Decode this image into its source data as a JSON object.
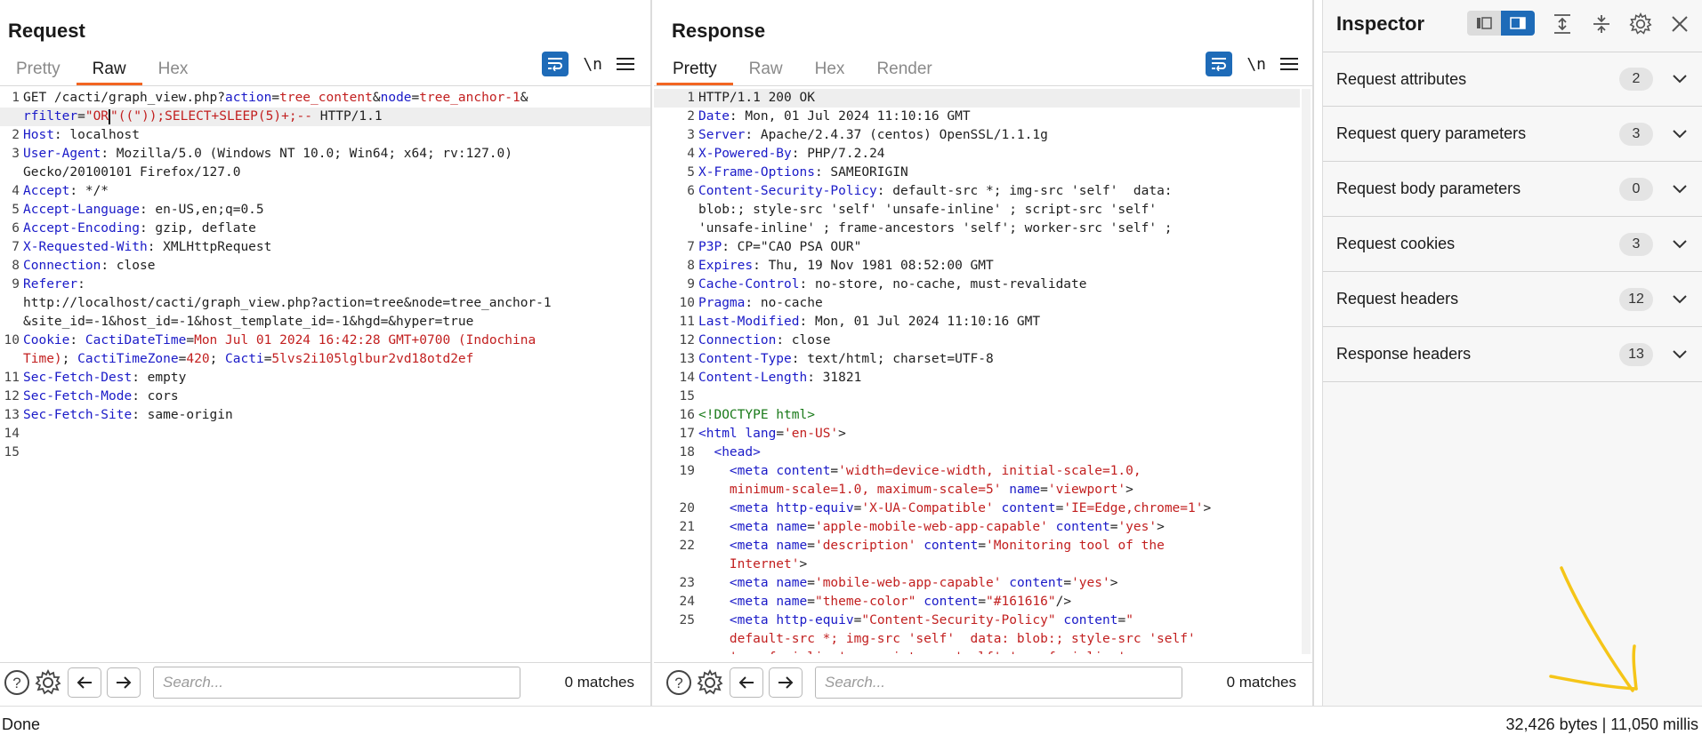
{
  "layout_toggle": {
    "options": [
      "side-by-side",
      "horizontal-split",
      "tabs"
    ],
    "active": "side-by-side"
  },
  "request": {
    "title": "Request",
    "tabs": [
      {
        "label": "Pretty",
        "active": false
      },
      {
        "label": "Raw",
        "active": true
      },
      {
        "label": "Hex",
        "active": false
      }
    ],
    "newline_label": "\\n",
    "search_placeholder": "Search...",
    "matches": "0 matches"
  },
  "response": {
    "title": "Response",
    "tabs": [
      {
        "label": "Pretty",
        "active": true
      },
      {
        "label": "Raw",
        "active": false
      },
      {
        "label": "Hex",
        "active": false
      },
      {
        "label": "Render",
        "active": false
      }
    ],
    "newline_label": "\\n",
    "search_placeholder": "Search...",
    "matches": "0 matches"
  },
  "inspector": {
    "title": "Inspector",
    "sections": [
      {
        "label": "Request attributes",
        "count": "2"
      },
      {
        "label": "Request query parameters",
        "count": "3"
      },
      {
        "label": "Request body parameters",
        "count": "0"
      },
      {
        "label": "Request cookies",
        "count": "3"
      },
      {
        "label": "Request headers",
        "count": "12"
      },
      {
        "label": "Response headers",
        "count": "13"
      }
    ]
  },
  "status": {
    "left": "Done",
    "right": "32,426 bytes | 11,050 millis"
  },
  "colors": {
    "accent": "#1e6bb8",
    "tab_underline": "#f26522",
    "key": "#1a1ac8",
    "value": "#c21f1f",
    "annotation": "#f5c518"
  }
}
